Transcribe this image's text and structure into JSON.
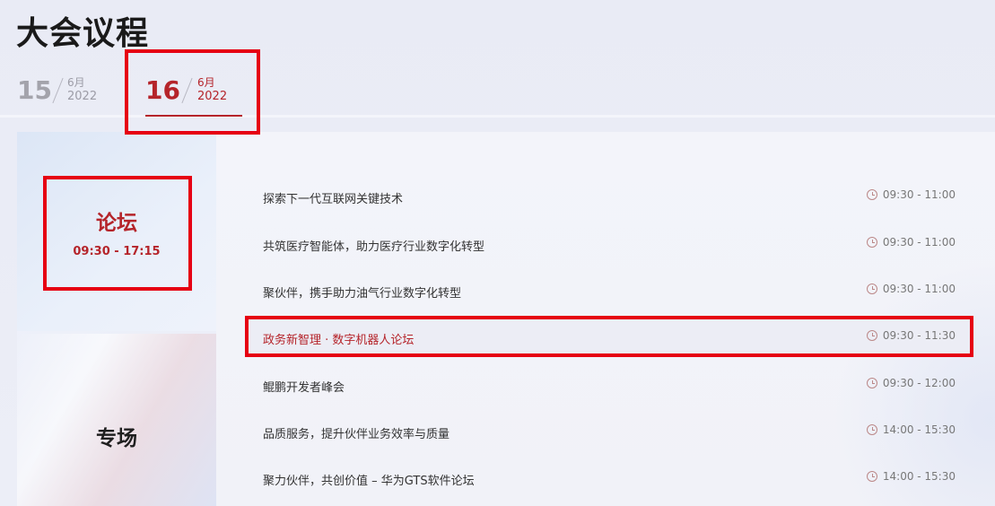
{
  "page": {
    "title": "大会议程"
  },
  "dates": [
    {
      "day": "15",
      "month": "6月",
      "year": "2022"
    },
    {
      "day": "16",
      "month": "6月",
      "year": "2022"
    }
  ],
  "sidebar": {
    "forum": {
      "name": "论坛",
      "time": "09:30 - 17:15"
    },
    "special": {
      "name": "专场"
    }
  },
  "agenda": [
    {
      "title": "探索下一代互联网关键技术",
      "time": "09:30 - 11:00"
    },
    {
      "title": "共筑医疗智能体，助力医疗行业数字化转型",
      "time": "09:30 - 11:00"
    },
    {
      "title": "聚伙伴，携手助力油气行业数字化转型",
      "time": "09:30 - 11:00"
    },
    {
      "title": "政务新智理 · 数字机器人论坛",
      "time": "09:30 - 11:30"
    },
    {
      "title": "鲲鹏开发者峰会",
      "time": "09:30 - 12:00"
    },
    {
      "title": "品质服务，提升伙伴业务效率与质量",
      "time": "14:00 - 15:30"
    },
    {
      "title": "聚力伙伴，共创价值 – 华为GTS软件论坛",
      "time": "14:00 - 15:30"
    }
  ],
  "colors": {
    "accent": "#b5242a",
    "highlight": "#e60012"
  },
  "icons": {
    "time": "clock-icon"
  }
}
